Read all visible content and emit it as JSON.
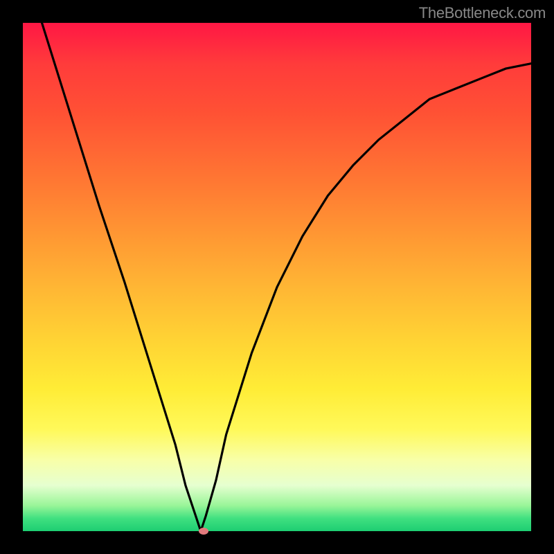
{
  "watermark": "TheBottleneck.com",
  "colors": {
    "background": "#000000",
    "curve": "#000000",
    "marker": "#e27a7d",
    "gradient_top": "#ff1744",
    "gradient_bottom": "#1dce72"
  },
  "chart_data": {
    "type": "line",
    "title": "",
    "xlabel": "",
    "ylabel": "",
    "xlim": [
      0,
      100
    ],
    "ylim": [
      0,
      100
    ],
    "grid": false,
    "legend": false,
    "series": [
      {
        "name": "bottleneck-curve",
        "x": [
          0,
          5,
          10,
          15,
          20,
          25,
          30,
          32,
          34,
          35,
          36,
          38,
          40,
          45,
          50,
          55,
          60,
          65,
          70,
          75,
          80,
          85,
          90,
          95,
          100
        ],
        "y": [
          112,
          96,
          80,
          64,
          49,
          33,
          17,
          9,
          3,
          0,
          3,
          10,
          19,
          35,
          48,
          58,
          66,
          72,
          77,
          81,
          85,
          87,
          89,
          91,
          92
        ]
      }
    ],
    "annotations": [
      {
        "name": "min-marker",
        "x": 35.5,
        "y": 0
      }
    ]
  }
}
